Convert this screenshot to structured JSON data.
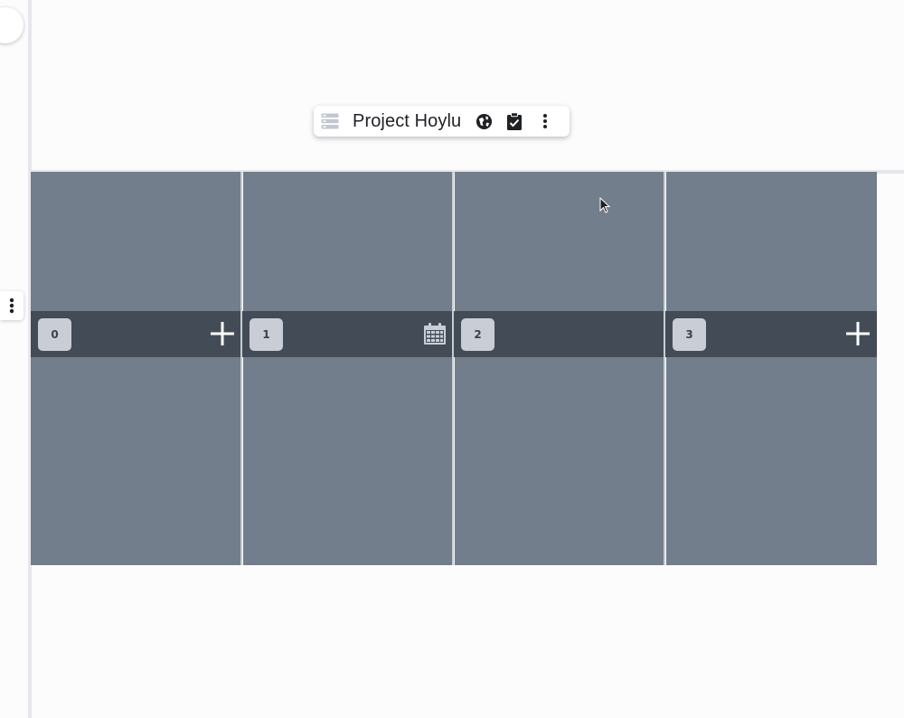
{
  "window": {
    "side_menu_icon": "more-vertical-icon"
  },
  "toolbar": {
    "doc_icon": "layout-panels-icon",
    "title": "Project Hoylu",
    "globe_icon": "globe-icon",
    "clipboard_icon": "clipboard-check-icon",
    "more_icon": "more-vertical-icon"
  },
  "board": {
    "column_color": "#727e8b",
    "band_color": "#434c56",
    "badge_color": "#c9ced6",
    "segments": [
      {
        "label": "0",
        "action_icon": "plus-icon"
      },
      {
        "label": "1",
        "action_icon": "calendar-icon"
      },
      {
        "label": "2",
        "action_icon": ""
      },
      {
        "label": "3",
        "action_icon": "plus-icon"
      }
    ]
  }
}
